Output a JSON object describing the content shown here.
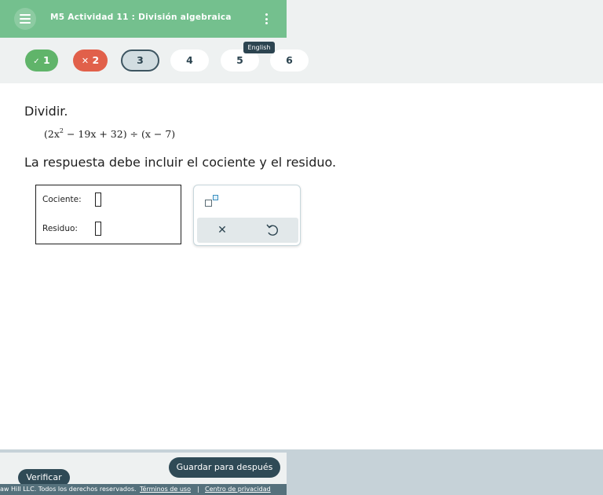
{
  "header": {
    "title": "M5 Actividad 11 : División algebraica",
    "color": "#74c08e"
  },
  "nav": {
    "items": [
      {
        "label": "1",
        "status": "correct",
        "icon": "check-icon"
      },
      {
        "label": "2",
        "status": "incorrect",
        "icon": "x-icon"
      },
      {
        "label": "3",
        "status": "current"
      },
      {
        "label": "4",
        "status": "unanswered"
      },
      {
        "label": "5",
        "status": "unanswered"
      },
      {
        "label": "6",
        "status": "unanswered"
      }
    ],
    "tooltip": "English",
    "correct_color": "#60b46a",
    "incorrect_color": "#e1604a"
  },
  "question": {
    "instruction": "Dividir.",
    "expression": {
      "open_paren": "(",
      "term1": "2x",
      "exp1": "2",
      "rest": " − 19x + 32",
      "close_div": ") ÷ (x − 7)"
    },
    "prompt": "La respuesta debe incluir el cociente y el residuo."
  },
  "answer": {
    "quotient_label": "Cociente:",
    "remainder_label": "Residuo:"
  },
  "palette": {
    "exponent_icon": "exponent-icon",
    "clear_icon": "clear-icon",
    "undo_icon": "undo-icon",
    "clear_glyph": "✕"
  },
  "footer": {
    "verify_label": "Verificar",
    "save_label": "Guardar para después",
    "copyright": "aw Hill LLC. Todos los derechos reservados.",
    "terms": "Términos de uso",
    "separator": "|",
    "privacy": "Centro de privacidad",
    "button_color": "#2f4a56"
  }
}
